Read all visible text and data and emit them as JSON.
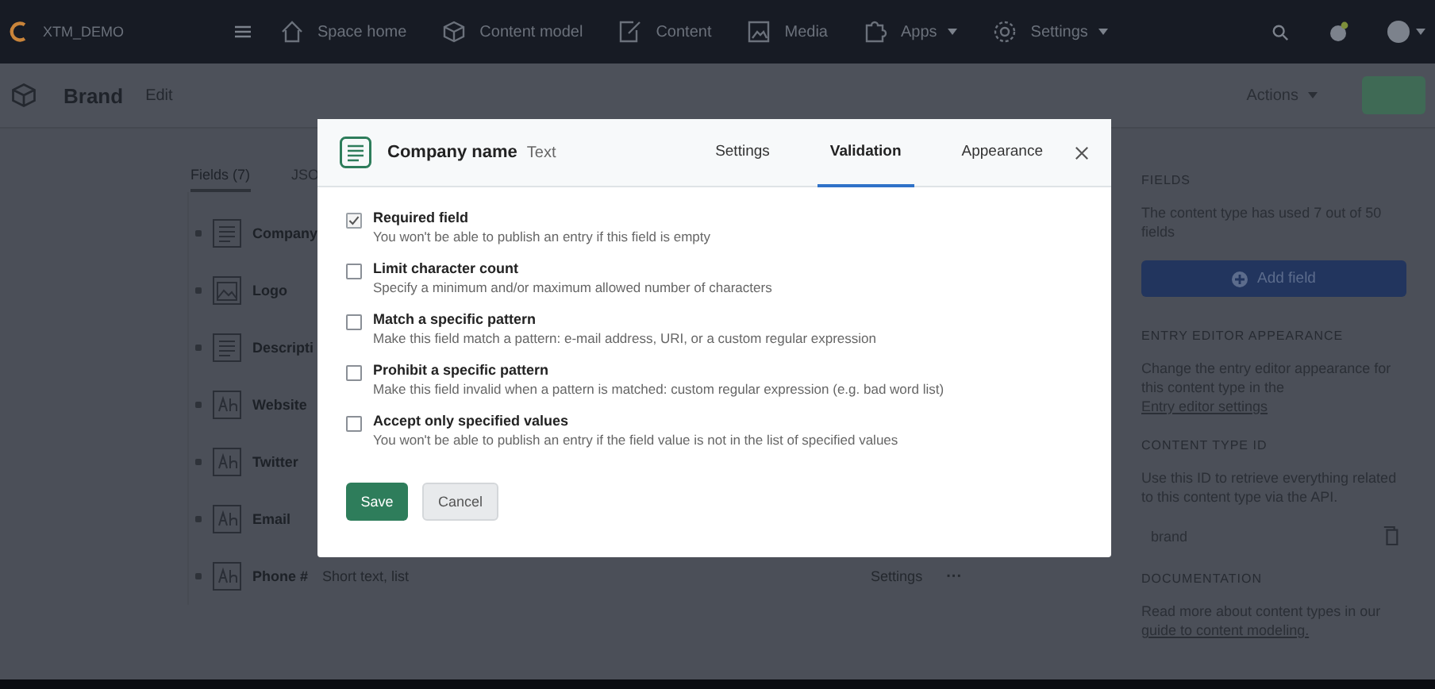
{
  "topbar": {
    "space": "XTM_DEMO",
    "nav": [
      {
        "label": "Space home",
        "kind": "home",
        "dropdown": false
      },
      {
        "label": "Content model",
        "kind": "model",
        "dropdown": false
      },
      {
        "label": "Content",
        "kind": "content",
        "dropdown": false
      },
      {
        "label": "Media",
        "kind": "media",
        "dropdown": false
      },
      {
        "label": "Apps",
        "kind": "apps",
        "dropdown": true
      },
      {
        "label": "Settings",
        "kind": "settings",
        "dropdown": true
      }
    ]
  },
  "header": {
    "title": "Brand",
    "subtitle": "Edit",
    "actions": "Actions"
  },
  "tabs": [
    {
      "label": "Fields (7)",
      "selected": true
    },
    {
      "label": "JSO",
      "selected": false
    }
  ],
  "fields": [
    {
      "name": "Company",
      "kind": "text"
    },
    {
      "name": "Logo",
      "kind": "media"
    },
    {
      "name": "Descripti",
      "kind": "text"
    },
    {
      "name": "Website",
      "kind": "short"
    },
    {
      "name": "Twitter",
      "kind": "short"
    },
    {
      "name": "Email",
      "kind": "short"
    },
    {
      "name": "Phone #",
      "kind": "short",
      "type": "Short text, list",
      "settings": "Settings",
      "more": "···"
    }
  ],
  "sidebar": {
    "fields_heading": "FIELDS",
    "fields_text": "The content type has used 7 out of 50 fields",
    "add_field": "Add field",
    "appearance_heading": "ENTRY EDITOR APPEARANCE",
    "appearance_text": "Change the entry editor appearance for this content type in the ",
    "appearance_link": "Entry editor settings",
    "id_heading": "CONTENT TYPE ID",
    "id_text": "Use this ID to retrieve everything related to this content type via the API.",
    "id_value": "brand",
    "docs_heading": "DOCUMENTATION",
    "docs_text": "Read more about content types in our ",
    "docs_link": "guide to content modeling."
  },
  "modal": {
    "title": "Company name",
    "type": "Text",
    "tabs": [
      {
        "label": "Settings",
        "selected": false
      },
      {
        "label": "Validation",
        "selected": true
      },
      {
        "label": "Appearance",
        "selected": false
      }
    ],
    "validations": [
      {
        "label": "Required field",
        "description": "You won't be able to publish an entry if this field is empty",
        "checked": true
      },
      {
        "label": "Limit character count",
        "description": "Specify a minimum and/or maximum allowed number of characters",
        "checked": false
      },
      {
        "label": "Match a specific pattern",
        "description": "Make this field match a pattern: e-mail address, URI, or a custom regular expression",
        "checked": false
      },
      {
        "label": "Prohibit a specific pattern",
        "description": "Make this field invalid when a pattern is matched: custom regular expression (e.g. bad word list)",
        "checked": false
      },
      {
        "label": "Accept only specified values",
        "description": "You won't be able to publish an entry if the field value is not in the list of specified values",
        "checked": false
      }
    ],
    "save": "Save",
    "cancel": "Cancel"
  }
}
